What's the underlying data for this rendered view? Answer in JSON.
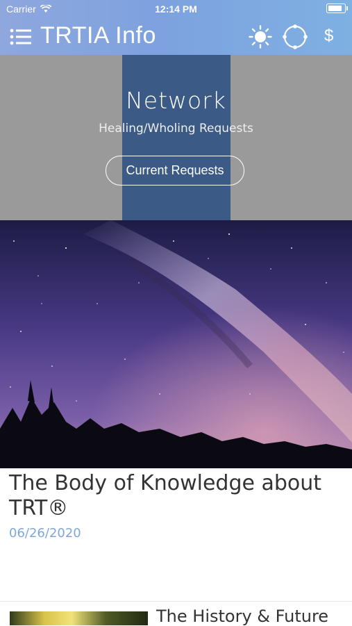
{
  "status_bar": {
    "carrier": "Carrier",
    "time": "12:14 PM",
    "battery_level": 0.95
  },
  "navbar": {
    "title": "TRTIA Info",
    "icons": [
      "menu-list-icon",
      "sun-icon",
      "circle-icon",
      "dollar-icon"
    ],
    "dollar_symbol": "$"
  },
  "hero": {
    "title": "Network",
    "subtitle": "Healing/Wholing Requests",
    "button_label": "Current Requests"
  },
  "article": {
    "title": "The Body of Knowledge about TRT®",
    "date": "06/26/2020"
  },
  "next_article": {
    "title": "The History & Future"
  },
  "colors": {
    "header_gradient": [
      "#8fa7dd",
      "#7eb0e2"
    ],
    "hero_gray": "#9a9a9a",
    "hero_band": "#3b5a85",
    "date_blue": "#7ea6dd"
  }
}
